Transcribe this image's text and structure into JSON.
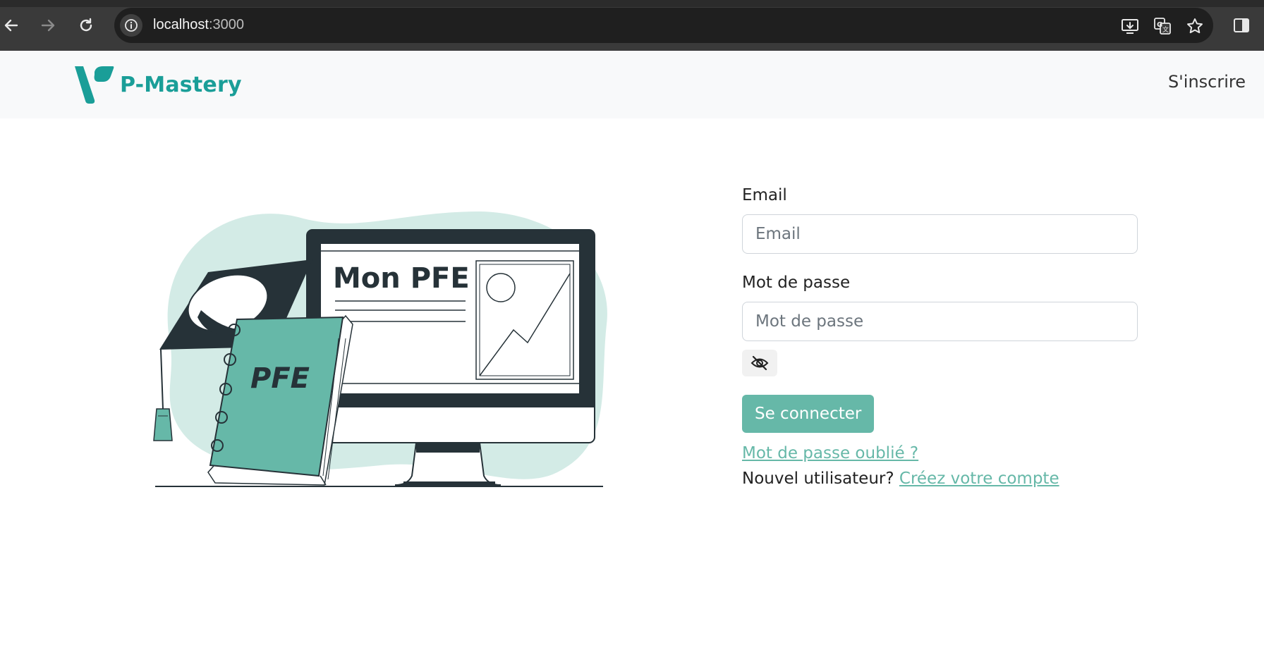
{
  "browser": {
    "url_host": "localhost",
    "url_port": ":3000",
    "back_icon": "arrow-left-icon",
    "forward_icon": "arrow-right-icon",
    "reload_icon": "reload-icon"
  },
  "navbar": {
    "brand": "P-Mastery",
    "signup": "S'inscrire"
  },
  "illustration": {
    "screen_title": "Mon PFE",
    "book_title": "PFE"
  },
  "form": {
    "email_label": "Email",
    "email_placeholder": "Email",
    "email_value": "",
    "password_label": "Mot de passe",
    "password_placeholder": "Mot de passe",
    "password_value": "",
    "toggle_icon": "eye-slash-icon",
    "submit_label": "Se connecter",
    "forgot_label": "Mot de passe oublié ?",
    "new_user_prefix": "Nouvel utilisateur? ",
    "create_account_label": "Créez votre compte"
  },
  "colors": {
    "brand": "#1a9e98",
    "accent": "#66b8a8",
    "blob": "#d3ebe6",
    "dark": "#263238"
  }
}
